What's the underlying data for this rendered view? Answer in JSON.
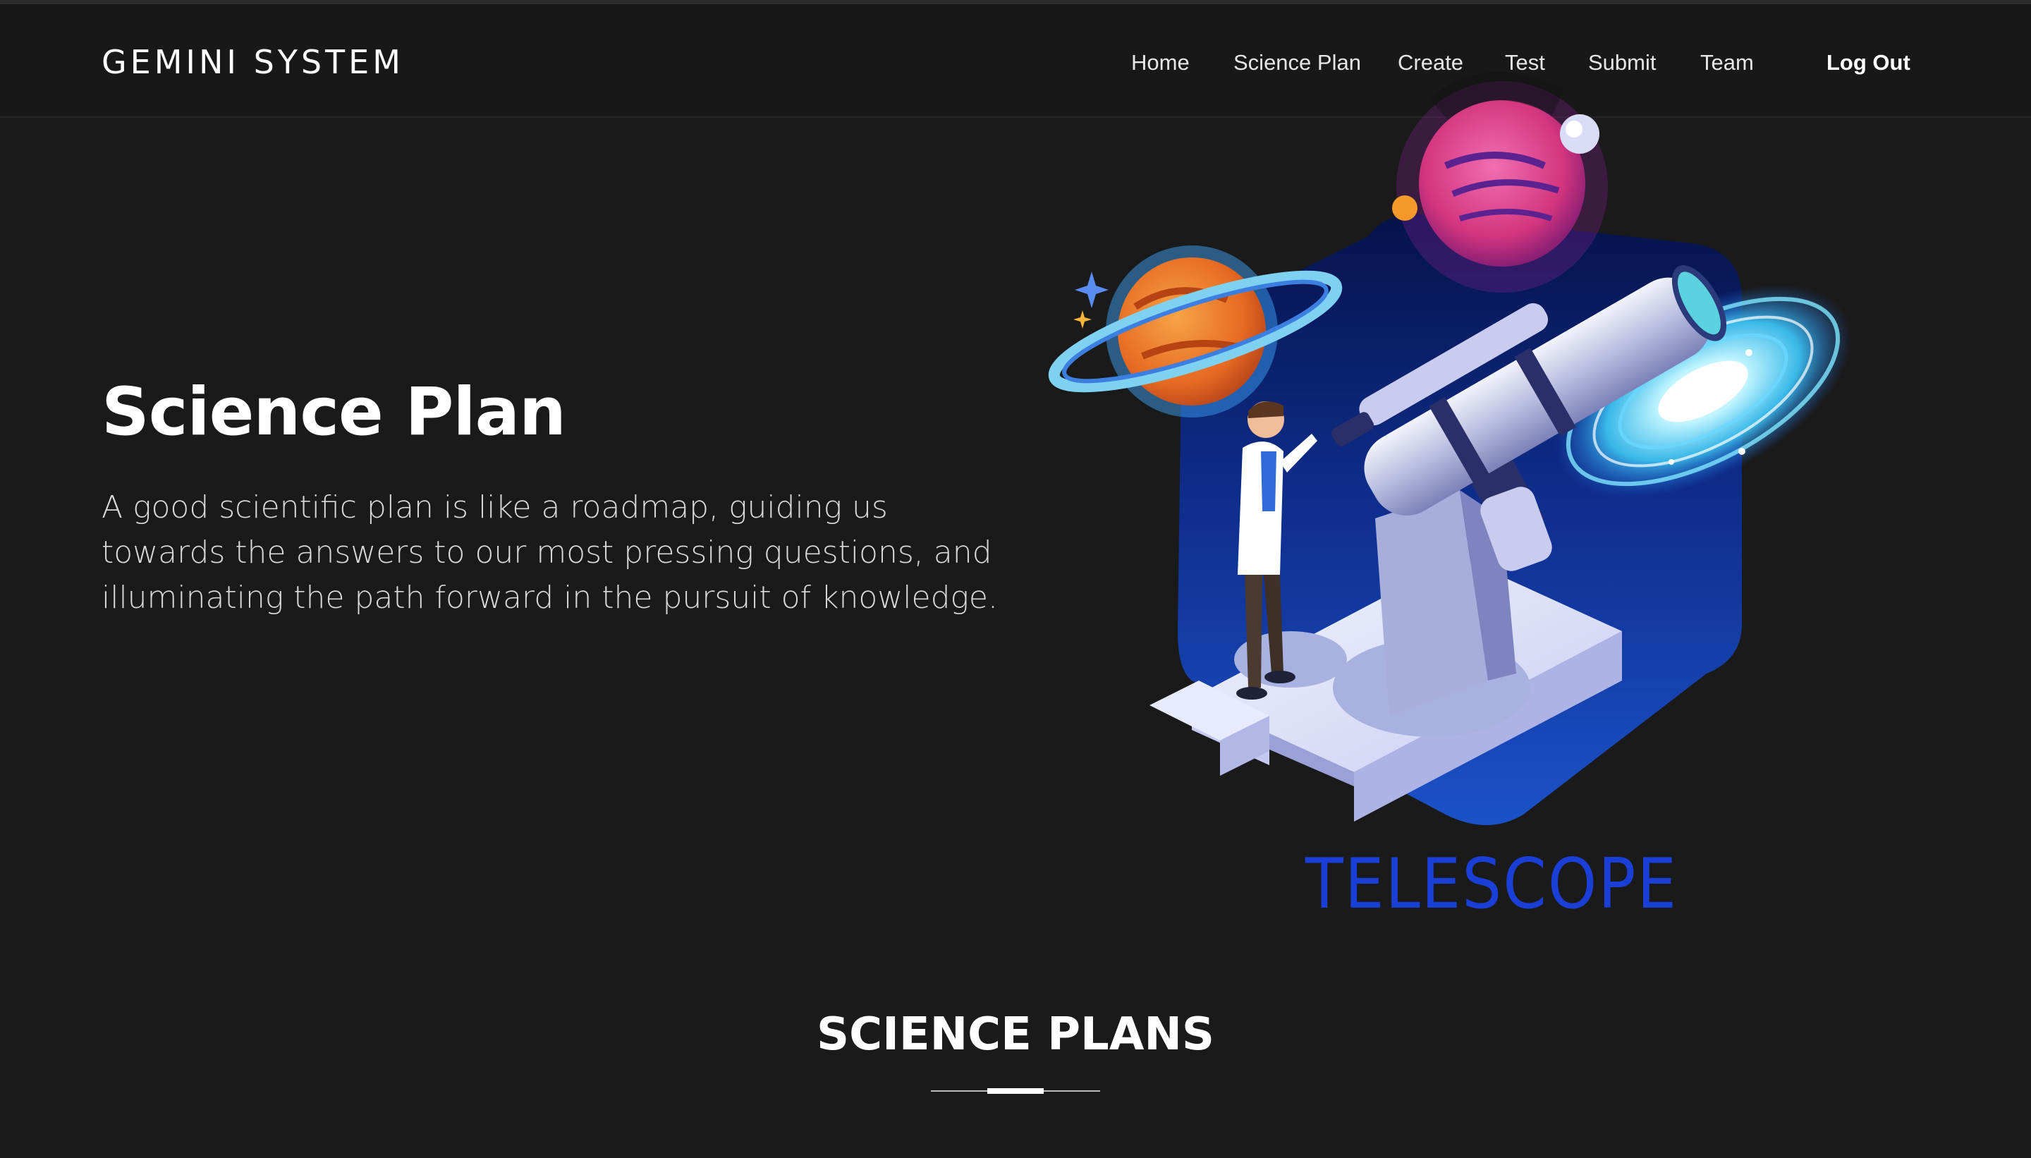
{
  "nav": {
    "brand": "GEMINI SYSTEM",
    "links": [
      "Home",
      "Science Plan",
      "Create",
      "Test",
      "Submit",
      "Team"
    ],
    "logout": "Log Out"
  },
  "hero": {
    "title": "Science Plan",
    "description": "A good scientific plan is like a roadmap, guiding us towards the answers to our most pressing questions, and illuminating the path forward in the pursuit of knowledge.",
    "illustration_label": "TELESCOPE"
  },
  "section": {
    "title": "SCIENCE PLANS"
  },
  "colors": {
    "background": "#1a1a1a",
    "navbar": "#181818",
    "hexagon_top": "#0a1a5c",
    "hexagon_bottom": "#1b4fc4",
    "label_blue": "#1a3fd6",
    "planet_pink": "#e0468f",
    "planet_orange": "#e86a25"
  }
}
